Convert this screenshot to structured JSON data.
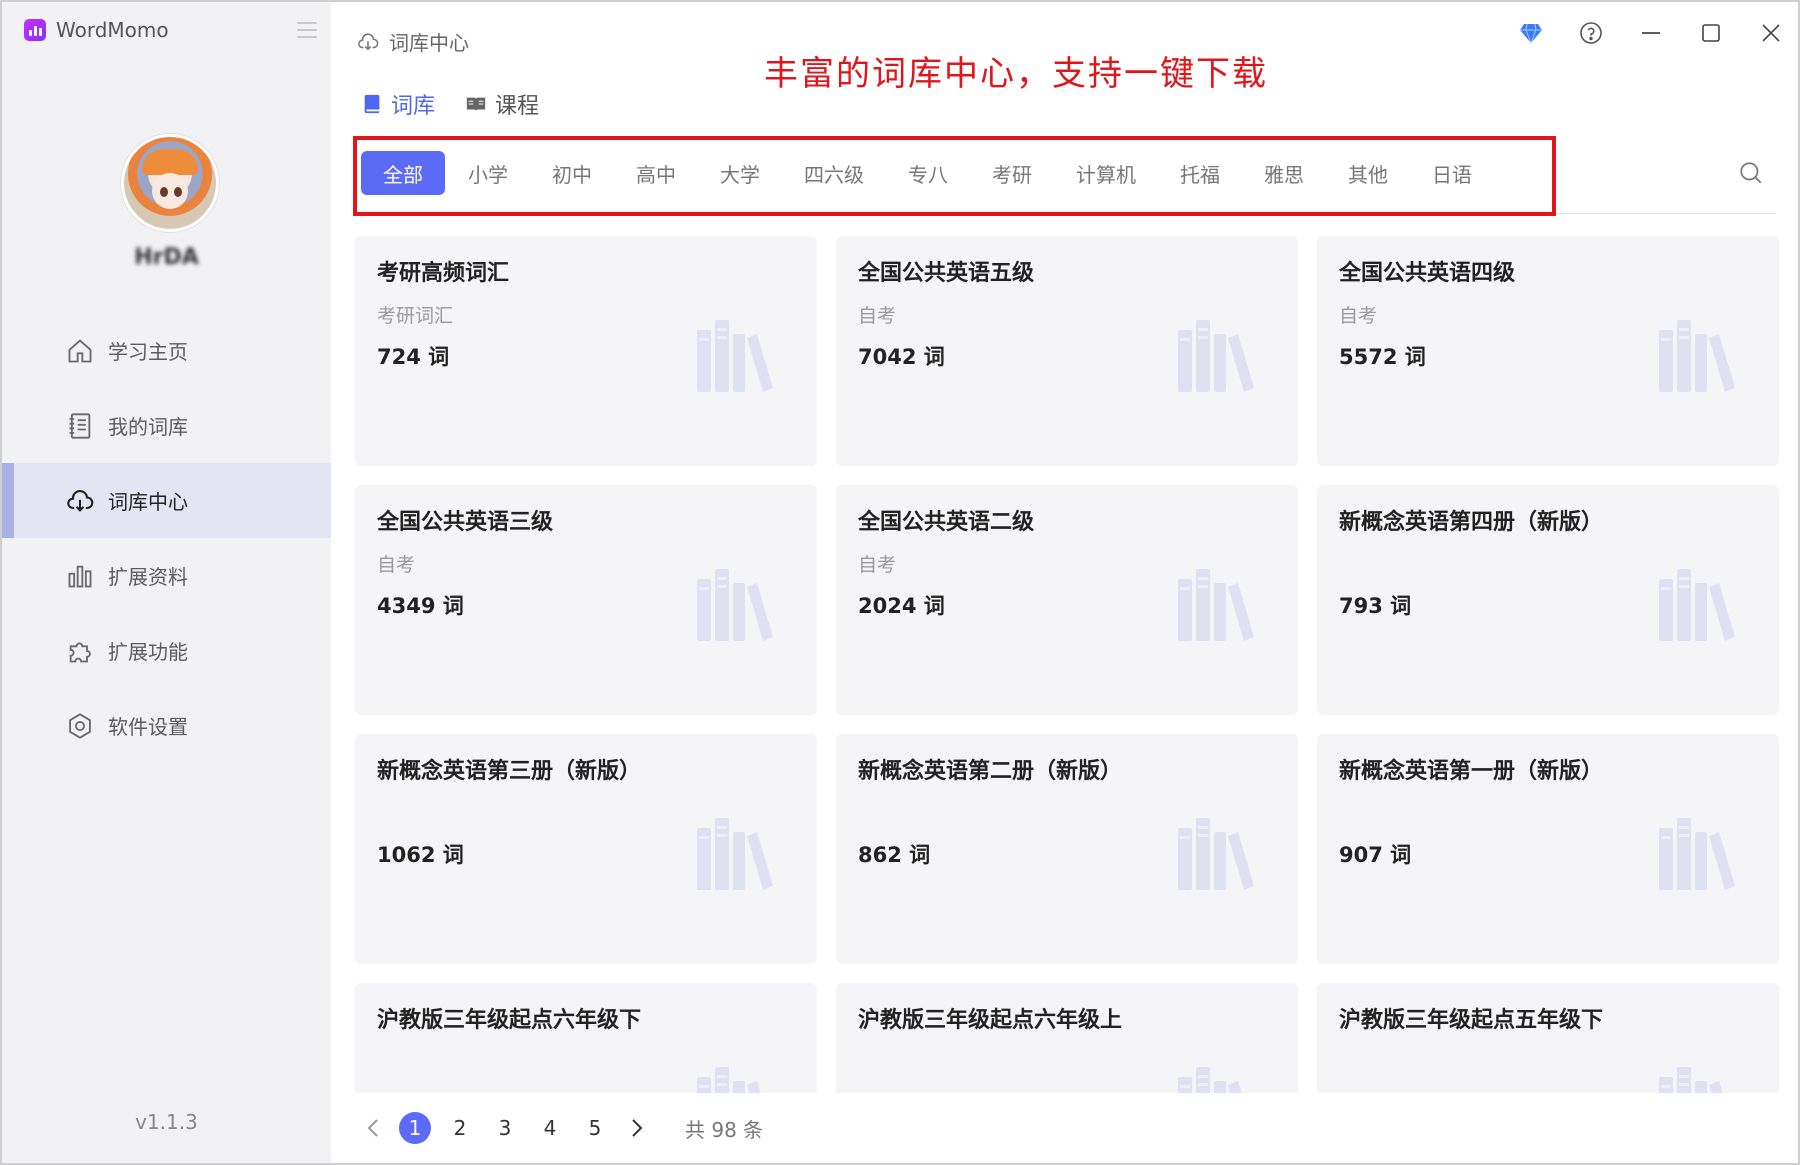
{
  "app": {
    "name": "WordMomo",
    "version": "v1.1.3"
  },
  "user": {
    "name": "HrDA"
  },
  "sidebar": {
    "items": [
      {
        "label": "学习主页",
        "icon": "home-icon"
      },
      {
        "label": "我的词库",
        "icon": "notebook-icon"
      },
      {
        "label": "词库中心",
        "icon": "cloud-download-icon",
        "active": true
      },
      {
        "label": "扩展资料",
        "icon": "bar-chart-icon"
      },
      {
        "label": "扩展功能",
        "icon": "puzzle-icon"
      },
      {
        "label": "软件设置",
        "icon": "settings-icon"
      }
    ]
  },
  "header": {
    "breadcrumb": "词库中心",
    "banner": "丰富的词库中心，支持一键下载"
  },
  "tabs": [
    {
      "label": "词库",
      "active": true
    },
    {
      "label": "课程"
    }
  ],
  "filters": [
    "全部",
    "小学",
    "初中",
    "高中",
    "大学",
    "四六级",
    "专八",
    "考研",
    "计算机",
    "托福",
    "雅思",
    "其他",
    "日语"
  ],
  "filter_active_index": 0,
  "cards": [
    {
      "title": "考研高频词汇",
      "subtitle": "考研词汇",
      "count": "724 词"
    },
    {
      "title": "全国公共英语五级",
      "subtitle": "自考",
      "count": "7042 词"
    },
    {
      "title": "全国公共英语四级",
      "subtitle": "自考",
      "count": "5572 词"
    },
    {
      "title": "全国公共英语三级",
      "subtitle": "自考",
      "count": "4349 词"
    },
    {
      "title": "全国公共英语二级",
      "subtitle": "自考",
      "count": "2024 词"
    },
    {
      "title": "新概念英语第四册（新版）",
      "subtitle": "",
      "count": "793 词"
    },
    {
      "title": "新概念英语第三册（新版）",
      "subtitle": "",
      "count": "1062 词"
    },
    {
      "title": "新概念英语第二册（新版）",
      "subtitle": "",
      "count": "862 词"
    },
    {
      "title": "新概念英语第一册（新版）",
      "subtitle": "",
      "count": "907 词"
    },
    {
      "title": "沪教版三年级起点六年级下",
      "subtitle": "",
      "count": ""
    },
    {
      "title": "沪教版三年级起点六年级上",
      "subtitle": "",
      "count": ""
    },
    {
      "title": "沪教版三年级起点五年级下",
      "subtitle": "",
      "count": ""
    }
  ],
  "pagination": {
    "pages": [
      "1",
      "2",
      "3",
      "4",
      "5"
    ],
    "current": "1",
    "total": "共 98 条"
  },
  "colors": {
    "accent": "#5b6bf5",
    "highlight": "#e0161b",
    "sidebar_bg": "#f2f2f4",
    "card_bg": "#f5f5f7"
  }
}
